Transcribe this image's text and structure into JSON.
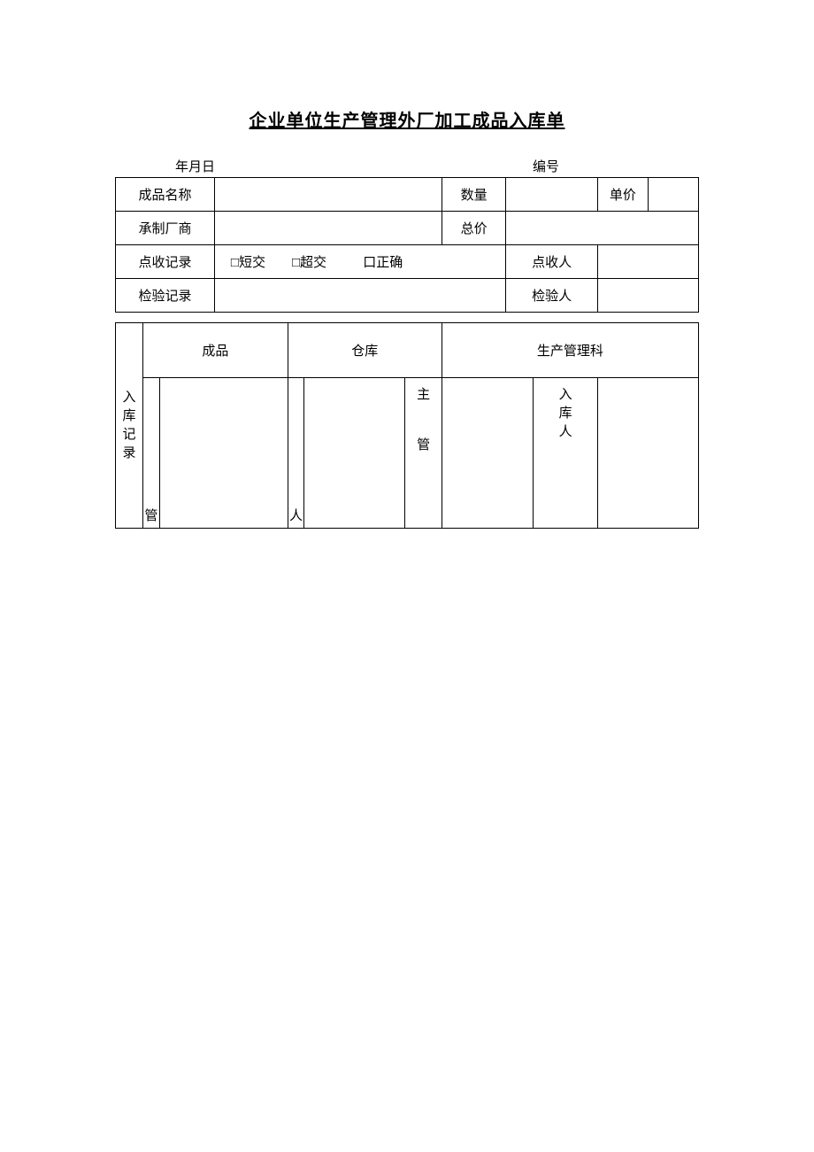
{
  "title": "企业单位生产管理外厂加工成品入库单",
  "meta": {
    "date_label": "年月日",
    "serial_label": "编号"
  },
  "rows": {
    "product_name_label": "成品名称",
    "product_name_value": "",
    "qty_label": "数量",
    "qty_value": "",
    "unit_price_label": "单价",
    "unit_price_value": "",
    "vendor_label": "承制厂商",
    "vendor_value": "",
    "total_label": "总价",
    "total_value": "",
    "receipt_record_label": "点收记录",
    "cb_short": "□短交",
    "cb_over": "□超交",
    "cb_correct": "口正确",
    "receiver_label": "点收人",
    "receiver_value": "",
    "inspect_record_label": "检验记录",
    "inspect_record_value": "",
    "inspector_label": "检验人",
    "inspector_value": ""
  },
  "section": {
    "storage_record_label": "入库记录",
    "col_product": "成品",
    "col_warehouse": "仓库",
    "col_dept": "生产管理科",
    "sub_guan": "管",
    "sub_ren": "人",
    "sub_zhuguan_1": "主",
    "sub_zhuguan_2": "管",
    "sub_ruku_1": "入",
    "sub_ruku_2": "库",
    "sub_ruku_3": "人"
  }
}
